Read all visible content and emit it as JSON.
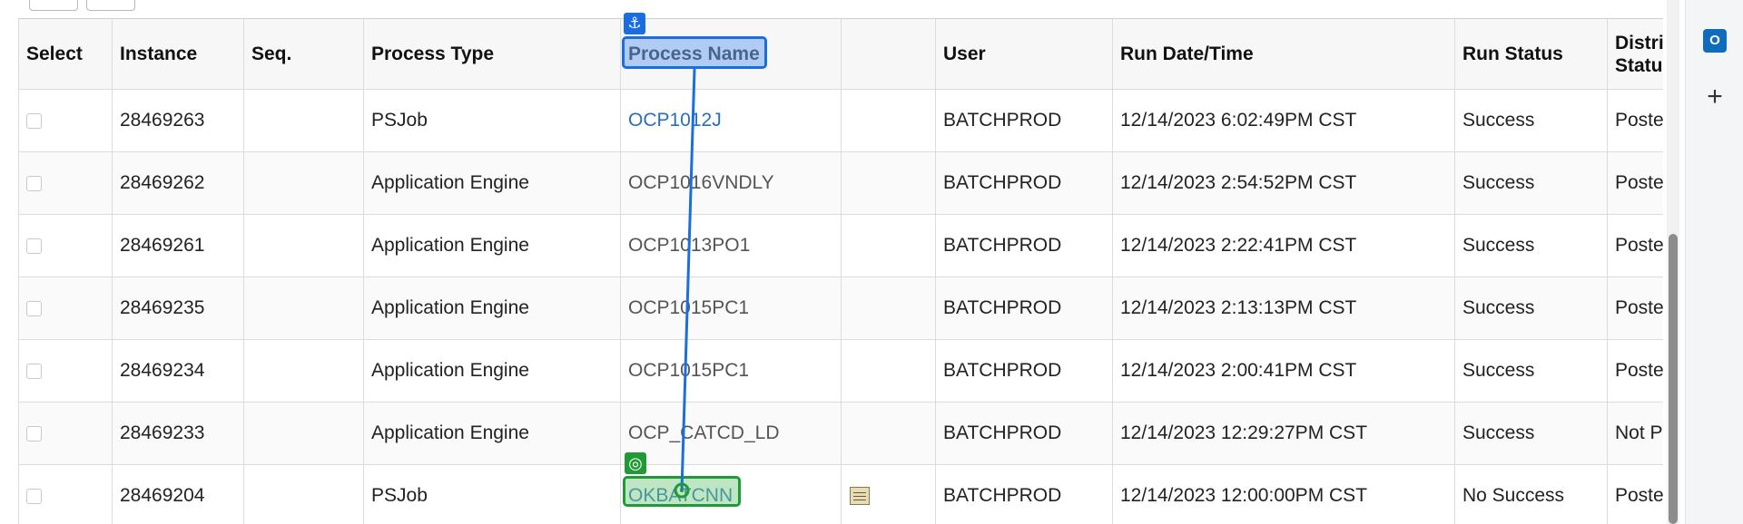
{
  "table": {
    "headers": {
      "select": "Select",
      "instance": "Instance",
      "seq": "Seq.",
      "process_type": "Process Type",
      "process_name": "Process Name",
      "details": "",
      "user": "User",
      "run_datetime": "Run Date/Time",
      "run_status": "Run Status",
      "dist_status_1": "Distri",
      "dist_status_2": "Statu"
    },
    "rows": [
      {
        "instance": "28469263",
        "seq": "",
        "process_type": "PSJob",
        "process_name": "OCP1012J",
        "user": "BATCHPROD",
        "run_datetime": "12/14/2023  6:02:49PM CST",
        "run_status": "Success",
        "dist_status": "Poste"
      },
      {
        "instance": "28469262",
        "seq": "",
        "process_type": "Application Engine",
        "process_name": "OCP1016VNDLY",
        "user": "BATCHPROD",
        "run_datetime": "12/14/2023  2:54:52PM CST",
        "run_status": "Success",
        "dist_status": "Poste"
      },
      {
        "instance": "28469261",
        "seq": "",
        "process_type": "Application Engine",
        "process_name": "OCP1013PO1",
        "user": "BATCHPROD",
        "run_datetime": "12/14/2023  2:22:41PM CST",
        "run_status": "Success",
        "dist_status": "Poste"
      },
      {
        "instance": "28469235",
        "seq": "",
        "process_type": "Application Engine",
        "process_name": "OCP1015PC1",
        "user": "BATCHPROD",
        "run_datetime": "12/14/2023  2:13:13PM CST",
        "run_status": "Success",
        "dist_status": "Poste"
      },
      {
        "instance": "28469234",
        "seq": "",
        "process_type": "Application Engine",
        "process_name": "OCP1015PC1",
        "user": "BATCHPROD",
        "run_datetime": "12/14/2023  2:00:41PM CST",
        "run_status": "Success",
        "dist_status": "Poste"
      },
      {
        "instance": "28469233",
        "seq": "",
        "process_type": "Application Engine",
        "process_name": "OCP_CATCD_LD",
        "user": "BATCHPROD",
        "run_datetime": "12/14/2023 12:29:27PM CST",
        "run_status": "Success",
        "dist_status": "Not P"
      },
      {
        "instance": "28469204",
        "seq": "",
        "process_type": "PSJob",
        "process_name": "OKBATCNN",
        "user": "BATCHPROD",
        "run_datetime": "12/14/2023 12:00:00PM CST",
        "run_status": "No Success",
        "dist_status": "Poste"
      }
    ]
  },
  "icons": {
    "anchor": "anchor-icon",
    "target": "target-icon",
    "details": "document-icon",
    "outlook": "outlook-icon",
    "add": "plus-icon"
  },
  "glyphs": {
    "anchor": "⚓",
    "target": "◎",
    "plus": "+",
    "outlook_letter": "O"
  },
  "colors": {
    "link": "#2a6ebb",
    "anchor_annotation": "#1a6fe0",
    "target_annotation": "#1f9a36",
    "scrollbar_thumb": "#8c8c8c"
  }
}
